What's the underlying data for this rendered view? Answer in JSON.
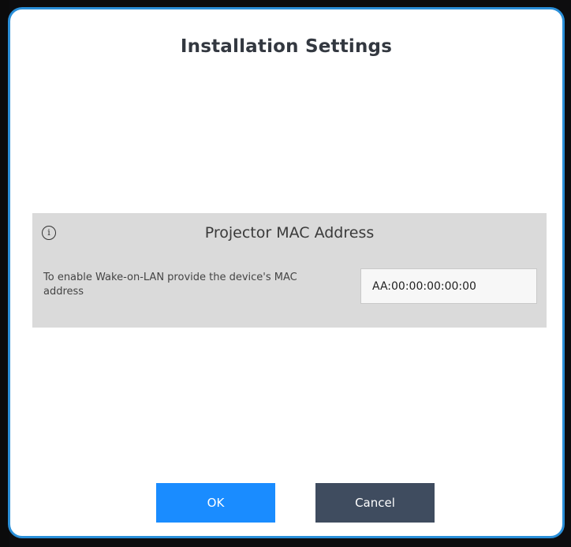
{
  "dialog": {
    "title": "Installation Settings"
  },
  "mac_panel": {
    "info_icon": "info-icon",
    "info_glyph": "i",
    "title": "Projector MAC Address",
    "description": "To enable Wake-on-LAN provide the device's MAC address",
    "mac_value": "AA:00:00:00:00:00"
  },
  "buttons": {
    "ok_label": "OK",
    "cancel_label": "Cancel"
  },
  "colors": {
    "dialog_border": "#2a8fd9",
    "panel_background": "#dadada",
    "ok_button": "#1a8cff",
    "cancel_button": "#3f4c5f"
  }
}
